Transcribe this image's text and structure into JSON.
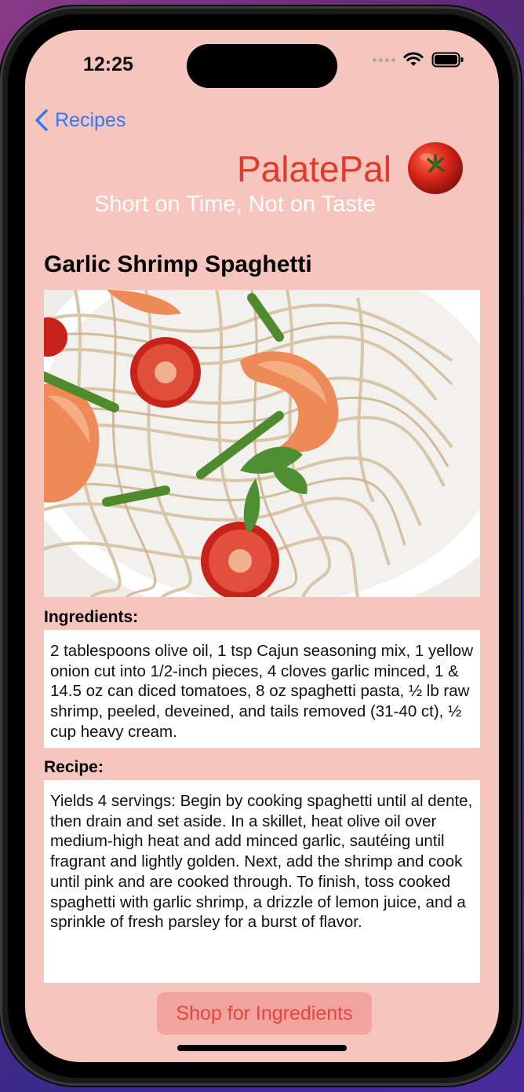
{
  "status_bar": {
    "time": "12:25"
  },
  "nav": {
    "back_label": "Recipes"
  },
  "header": {
    "app_name": "PalatePal",
    "tagline": "Short on Time, Not on Taste",
    "logo_icon": "tomato-icon"
  },
  "recipe": {
    "title": "Garlic Shrimp Spaghetti",
    "ingredients_label": "Ingredients:",
    "ingredients_text": "2 tablespoons olive oil, 1 tsp Cajun seasoning mix, 1 yellow onion cut into 1/2-inch pieces, 4 cloves garlic minced, 1 & 14.5 oz can diced tomatoes, 8 oz spaghetti pasta, ½ lb raw shrimp, peeled, deveined, and tails removed (31-40 ct), ½ cup heavy cream.",
    "recipe_label": "Recipe:",
    "recipe_text": "Yields 4 servings: Begin by cooking spaghetti until al dente, then drain and set aside. In a skillet, heat olive oil over medium-high heat and add minced garlic, sautéing until fragrant and lightly golden. Next, add the shrimp and cook until pink and are cooked through. To finish, toss cooked spaghetti with garlic shrimp, a drizzle of lemon juice, and a sprinkle of fresh parsley for a burst of flavor."
  },
  "actions": {
    "shop_label": "Shop for Ingredients"
  },
  "colors": {
    "background": "#f6c5be",
    "accent_red": "#e23a2a",
    "link_blue": "#3478f6",
    "button_bg": "#f1a39e"
  }
}
